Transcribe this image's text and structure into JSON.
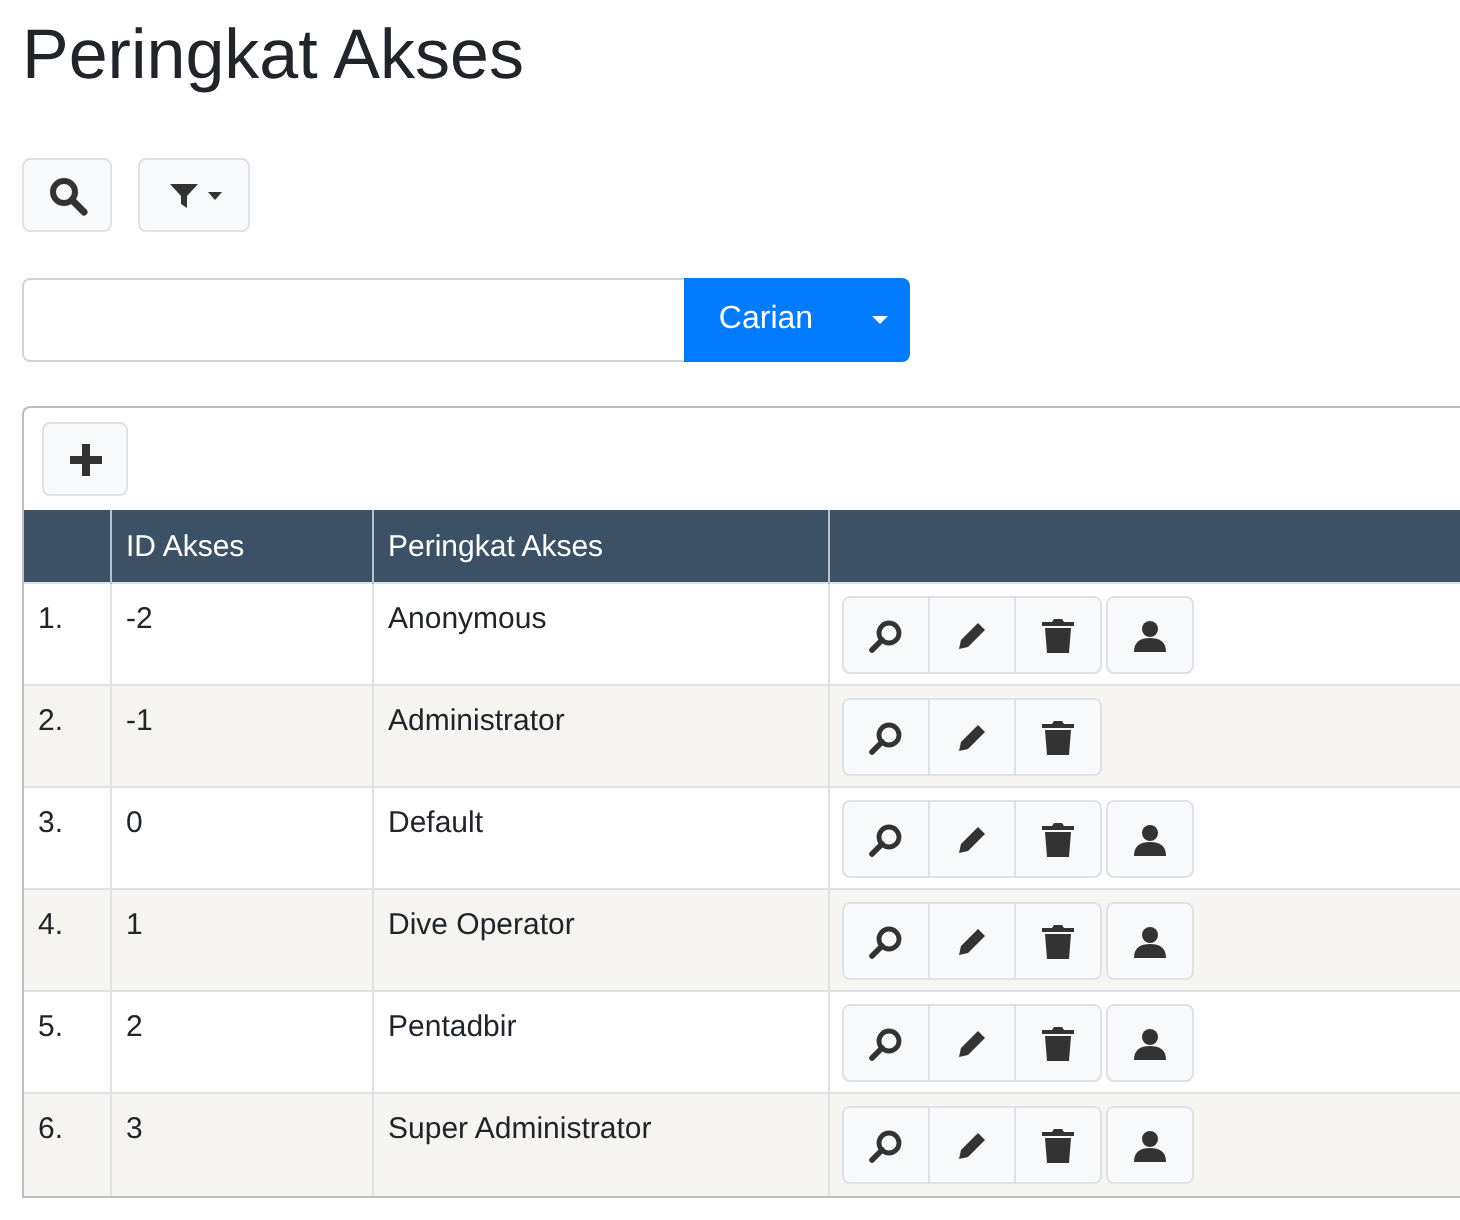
{
  "title": "Peringkat Akses",
  "search": {
    "button_label": "Carian"
  },
  "table": {
    "columns": [
      "ID Akses",
      "Peringkat Akses"
    ],
    "rows": [
      {
        "number": "1.",
        "id": "-2",
        "name": "Anonymous",
        "actions": [
          {
            "kind": "view"
          },
          {
            "kind": "edit"
          },
          {
            "kind": "delete"
          },
          {
            "kind": "permissions"
          }
        ]
      },
      {
        "number": "2.",
        "id": "-1",
        "name": "Administrator",
        "actions": [
          {
            "kind": "view"
          },
          {
            "kind": "edit"
          },
          {
            "kind": "delete"
          }
        ]
      },
      {
        "number": "3.",
        "id": "0",
        "name": "Default",
        "actions": [
          {
            "kind": "view"
          },
          {
            "kind": "edit"
          },
          {
            "kind": "delete"
          },
          {
            "kind": "permissions"
          }
        ]
      },
      {
        "number": "4.",
        "id": "1",
        "name": "Dive Operator",
        "actions": [
          {
            "kind": "view"
          },
          {
            "kind": "edit"
          },
          {
            "kind": "delete"
          },
          {
            "kind": "permissions"
          }
        ]
      },
      {
        "number": "5.",
        "id": "2",
        "name": "Pentadbir",
        "actions": [
          {
            "kind": "view"
          },
          {
            "kind": "edit"
          },
          {
            "kind": "delete"
          },
          {
            "kind": "permissions"
          }
        ]
      },
      {
        "number": "6.",
        "id": "3",
        "name": "Super Administrator",
        "actions": [
          {
            "kind": "view"
          },
          {
            "kind": "edit"
          },
          {
            "kind": "delete"
          },
          {
            "kind": "permissions"
          }
        ]
      }
    ]
  }
}
